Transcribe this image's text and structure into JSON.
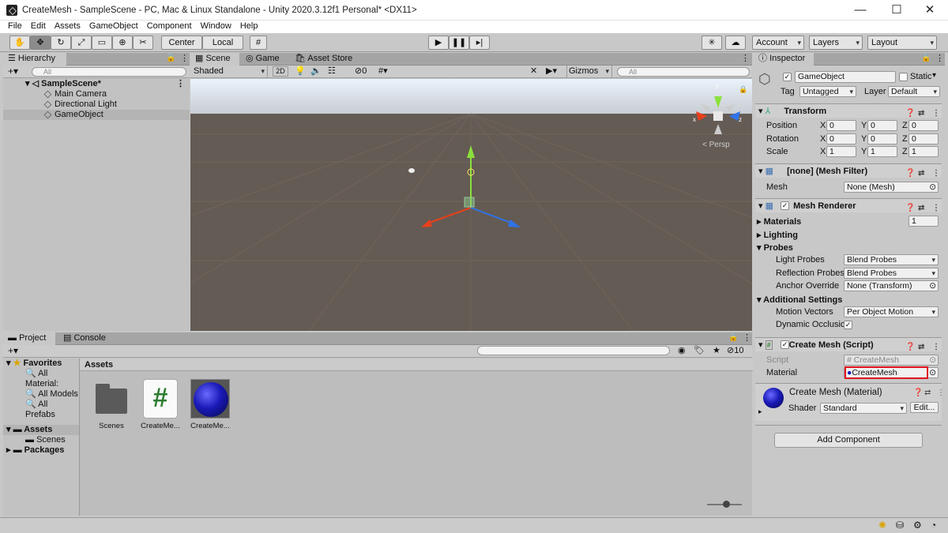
{
  "window": {
    "title": "CreateMesh - SampleScene - PC, Mac & Linux Standalone - Unity 2020.3.12f1 Personal* <DX11>",
    "min": "—",
    "max": "☐",
    "close": "✕"
  },
  "menu": [
    "File",
    "Edit",
    "Assets",
    "GameObject",
    "Component",
    "Window",
    "Help"
  ],
  "toolbar": {
    "center": "Center",
    "local": "Local",
    "account": "Account",
    "layers": "Layers",
    "layout": "Layout"
  },
  "hierarchy": {
    "tab": "Hierarchy",
    "search_placeholder": "All",
    "scene": "SampleScene*",
    "items": [
      "Main Camera",
      "Directional Light",
      "GameObject"
    ]
  },
  "scene_view": {
    "tabs": [
      "Scene",
      "Game",
      "Asset Store"
    ],
    "shading": "Shaded",
    "mode2d": "2D",
    "hidden_count": "0",
    "gizmos": "Gizmos",
    "search_placeholder": "All",
    "persp": "< Persp",
    "axis_y": "y",
    "axis_x": "x",
    "axis_z": "z"
  },
  "project": {
    "tabs": [
      "Project",
      "Console"
    ],
    "favorites": "Favorites",
    "fav_items": [
      "All Material:",
      "All Models",
      "All Prefabs"
    ],
    "assets": "Assets",
    "asset_children": [
      "Scenes"
    ],
    "packages": "Packages",
    "breadcrumb": "Assets",
    "files": [
      "Scenes",
      "CreateMe...",
      "CreateMe..."
    ],
    "hidden_count": "10"
  },
  "inspector": {
    "tab": "Inspector",
    "object_name": "GameObject",
    "static": "Static",
    "tag_label": "Tag",
    "tag": "Untagged",
    "layer_label": "Layer",
    "layer": "Default",
    "transform": {
      "title": "Transform",
      "rows": [
        {
          "label": "Position",
          "x": "0",
          "y": "0",
          "z": "0"
        },
        {
          "label": "Rotation",
          "x": "0",
          "y": "0",
          "z": "0"
        },
        {
          "label": "Scale",
          "x": "1",
          "y": "1",
          "z": "1"
        }
      ]
    },
    "mesh_filter": {
      "title": "[none] (Mesh Filter)",
      "mesh_label": "Mesh",
      "mesh": "None (Mesh)"
    },
    "mesh_renderer": {
      "title": "Mesh Renderer",
      "materials": "Materials",
      "materials_count": "1",
      "lighting": "Lighting",
      "probes": "Probes",
      "light_probes_label": "Light Probes",
      "light_probes": "Blend Probes",
      "reflection_probes_label": "Reflection Probes",
      "reflection_probes": "Blend Probes",
      "anchor_label": "Anchor Override",
      "anchor": "None (Transform)",
      "additional": "Additional Settings",
      "motion_label": "Motion Vectors",
      "motion": "Per Object Motion",
      "dynamic_label": "Dynamic Occlusic"
    },
    "script_comp": {
      "title": "Create Mesh (Script)",
      "script_label": "Script",
      "script": "CreateMesh",
      "material_label": "Material",
      "material": "CreateMesh"
    },
    "material": {
      "title": "Create Mesh (Material)",
      "shader_label": "Shader",
      "shader": "Standard",
      "edit": "Edit..."
    },
    "add_component": "Add Component"
  },
  "colors": {
    "highlight": "#e0141e",
    "sphere": "#1a1ab8",
    "script_green": "#2e7d32"
  }
}
